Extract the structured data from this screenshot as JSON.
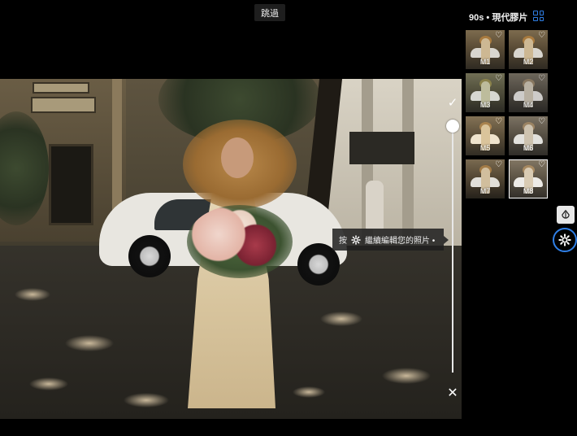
{
  "top": {
    "skip_label": "跳過"
  },
  "panel": {
    "title": "90s • 現代膠片",
    "thumbnails": [
      {
        "label": "M1",
        "selected": false
      },
      {
        "label": "M2",
        "selected": false
      },
      {
        "label": "M3",
        "selected": false
      },
      {
        "label": "M4",
        "selected": false
      },
      {
        "label": "M5",
        "selected": false
      },
      {
        "label": "M6",
        "selected": false
      },
      {
        "label": "M7",
        "selected": false
      },
      {
        "label": "M8",
        "selected": true
      }
    ]
  },
  "tooltip": {
    "prefix": "按",
    "text": "繼續編輯您的照片 •"
  },
  "slider": {
    "value_percent": 100
  },
  "colors": {
    "accent": "#2f7fe6",
    "background": "#000000"
  },
  "icons": {
    "check": "check-icon",
    "close": "close-icon",
    "heart": "heart-icon",
    "grid": "grid-icon",
    "compare": "compare-icon",
    "settings": "gear-icon"
  }
}
